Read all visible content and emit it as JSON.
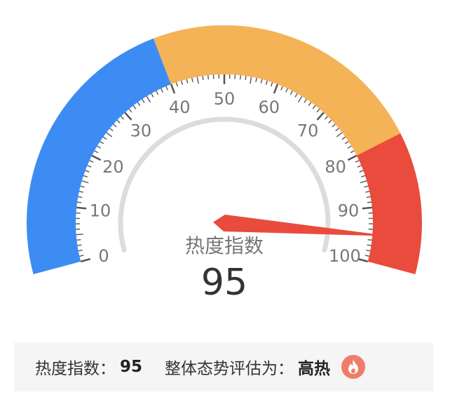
{
  "chart_data": {
    "type": "gauge",
    "min": 0,
    "max": 100,
    "value": 95,
    "center_label": "热度指数",
    "tick_labels": [
      "0",
      "10",
      "20",
      "30",
      "40",
      "50",
      "60",
      "70",
      "80",
      "90",
      "100"
    ],
    "bands": [
      {
        "from": 0,
        "to": 40,
        "color": "#3d8cf4"
      },
      {
        "from": 40,
        "to": 80,
        "color": "#f5b357"
      },
      {
        "from": 80,
        "to": 100,
        "color": "#e94b3c"
      }
    ],
    "needle_color": "#e94b3c"
  },
  "summary": {
    "index_label": "热度指数：",
    "index_value": "95",
    "assessment_label": "整体态势评估为：",
    "assessment_value": "高热",
    "icon": "fire-icon"
  }
}
